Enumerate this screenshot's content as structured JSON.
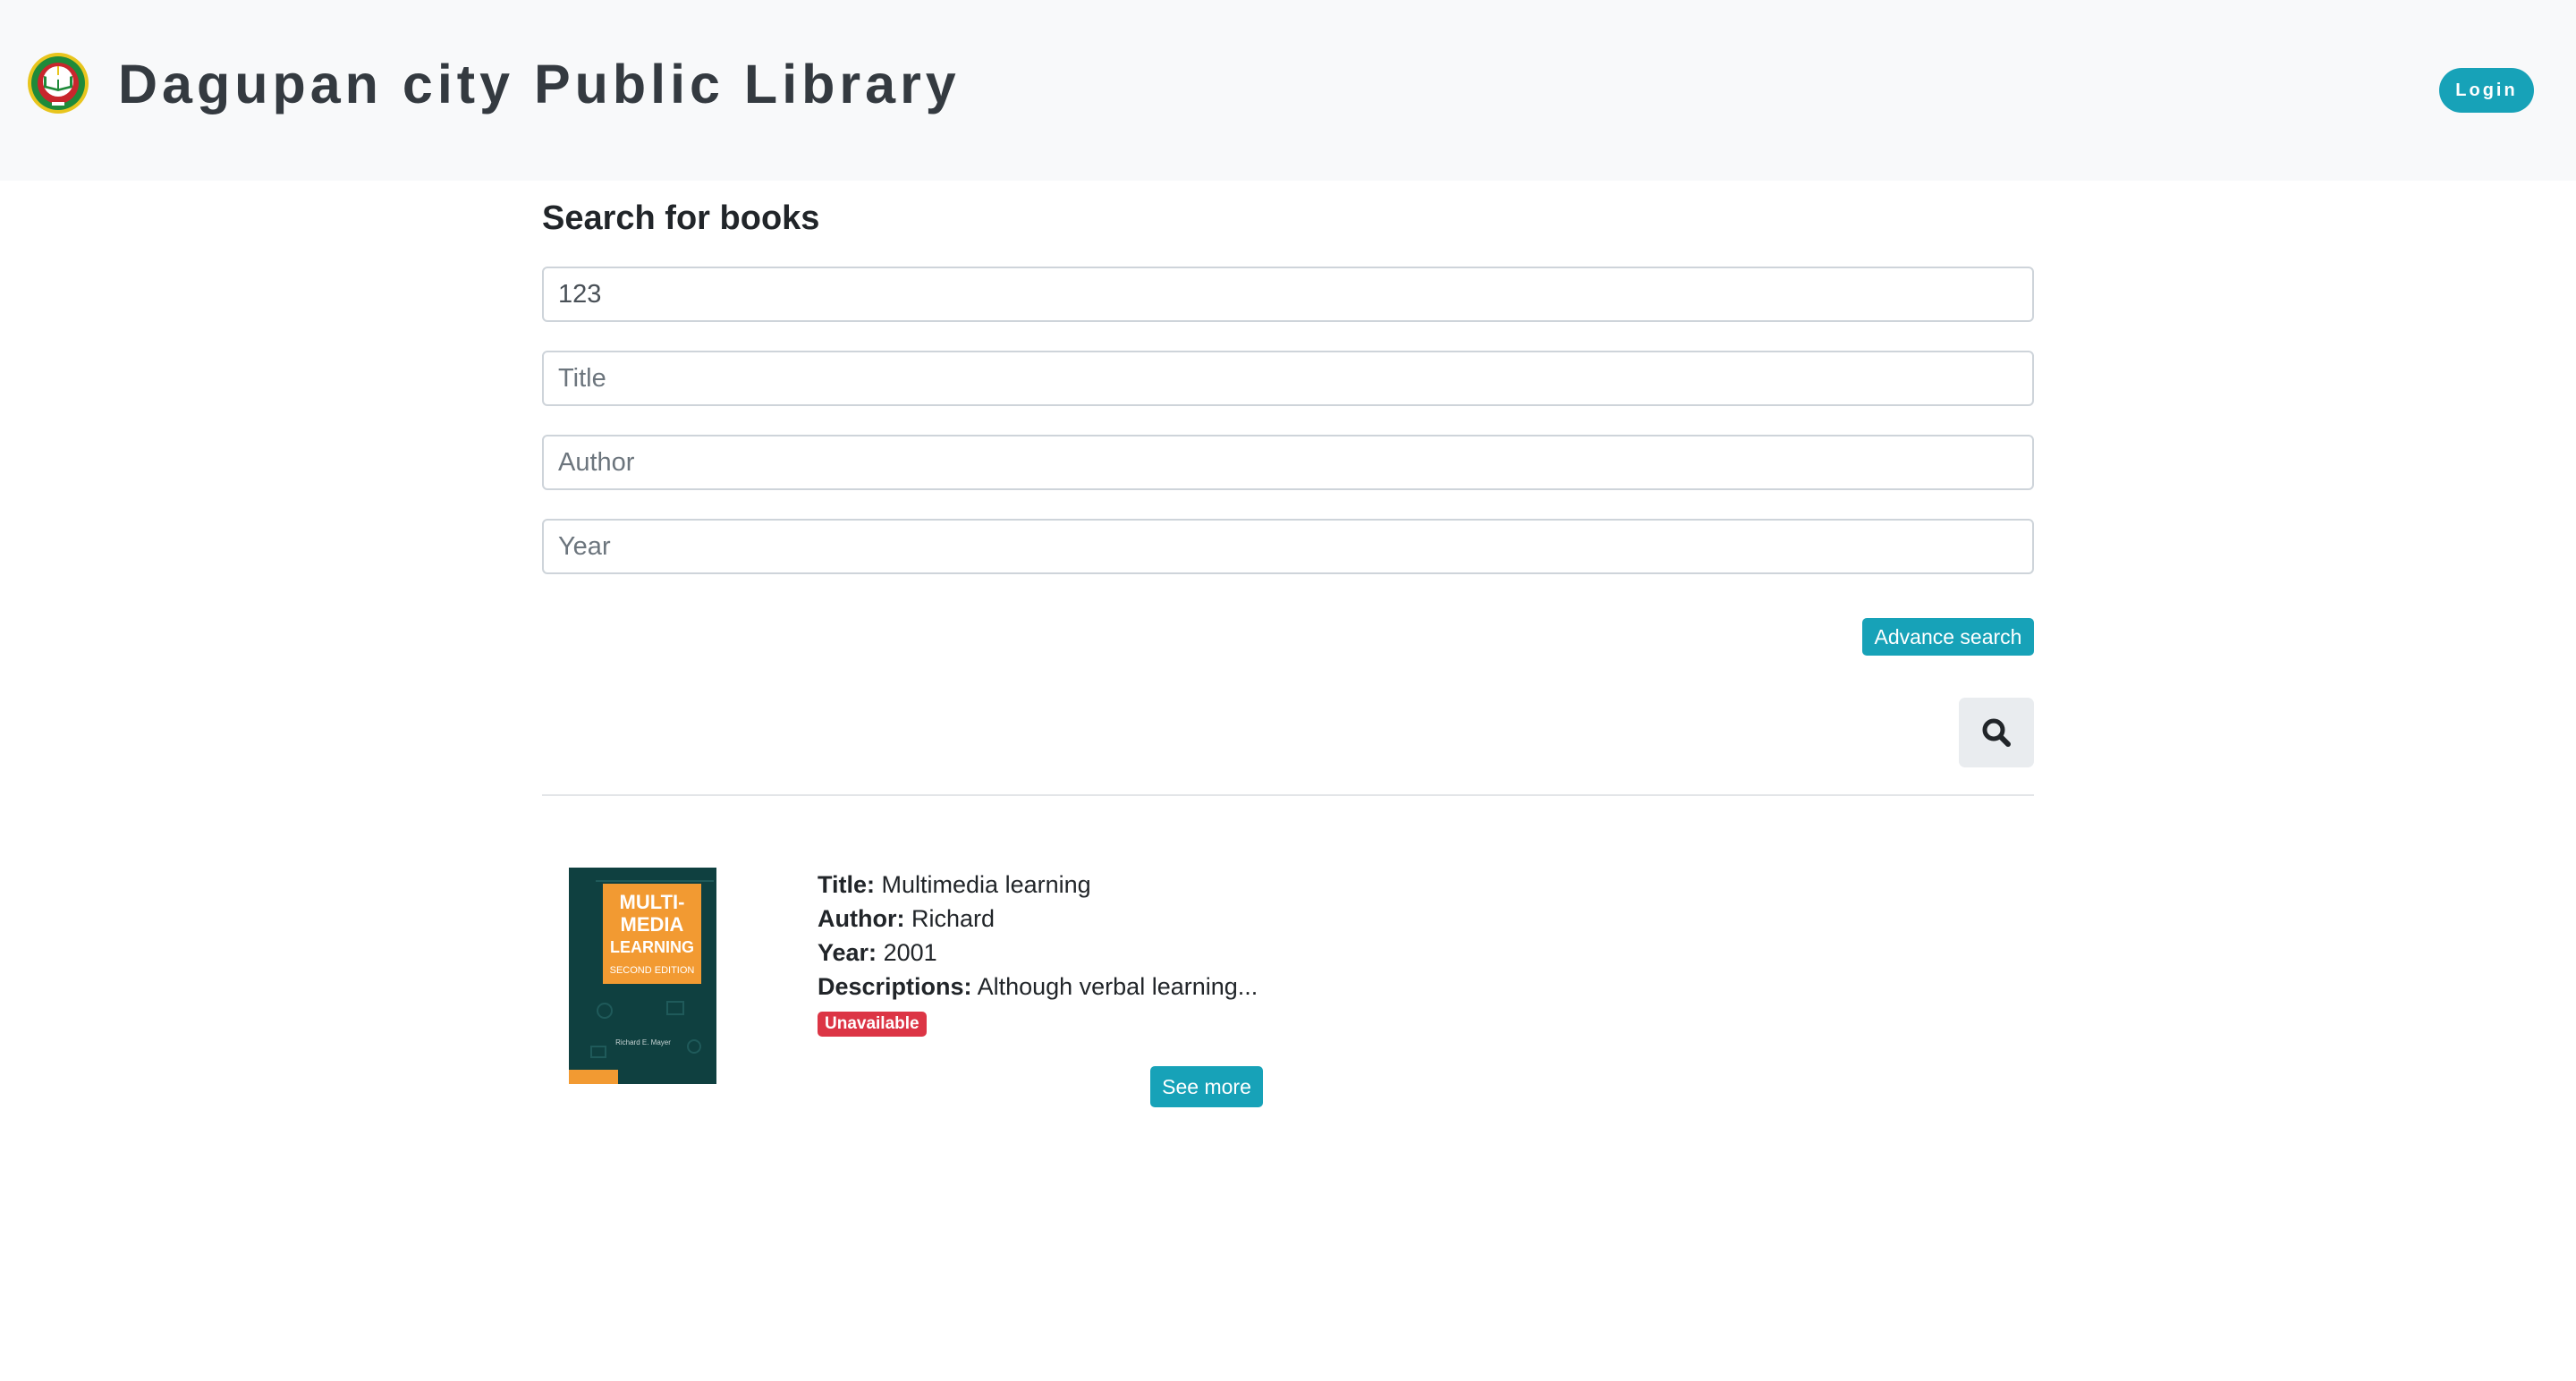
{
  "header": {
    "title": "Dagupan city Public Library",
    "login_label": "Login",
    "logo_icon": "library-seal-icon"
  },
  "search": {
    "heading": "Search for books",
    "keyword_value": "123",
    "title_placeholder": "Title",
    "author_placeholder": "Author",
    "year_placeholder": "Year",
    "advance_label": "Advance search",
    "search_icon": "search-icon"
  },
  "results": [
    {
      "cover_text": [
        "MULTI-",
        "MEDIA",
        "LEARNING",
        "SECOND EDITION",
        "Richard E. Mayer"
      ],
      "title_label": "Title:",
      "title": "Multimedia learning",
      "author_label": "Author:",
      "author": "Richard",
      "year_label": "Year:",
      "year": "2001",
      "description_label": "Descriptions:",
      "description": "Although verbal learning...",
      "status": "Unavailable",
      "see_more_label": "See more"
    }
  ],
  "colors": {
    "accent": "#17a2b8",
    "danger": "#dc3545",
    "navbar_bg": "#f8f9fa",
    "cover_bg": "#0f4040",
    "cover_accent": "#f29a32"
  }
}
